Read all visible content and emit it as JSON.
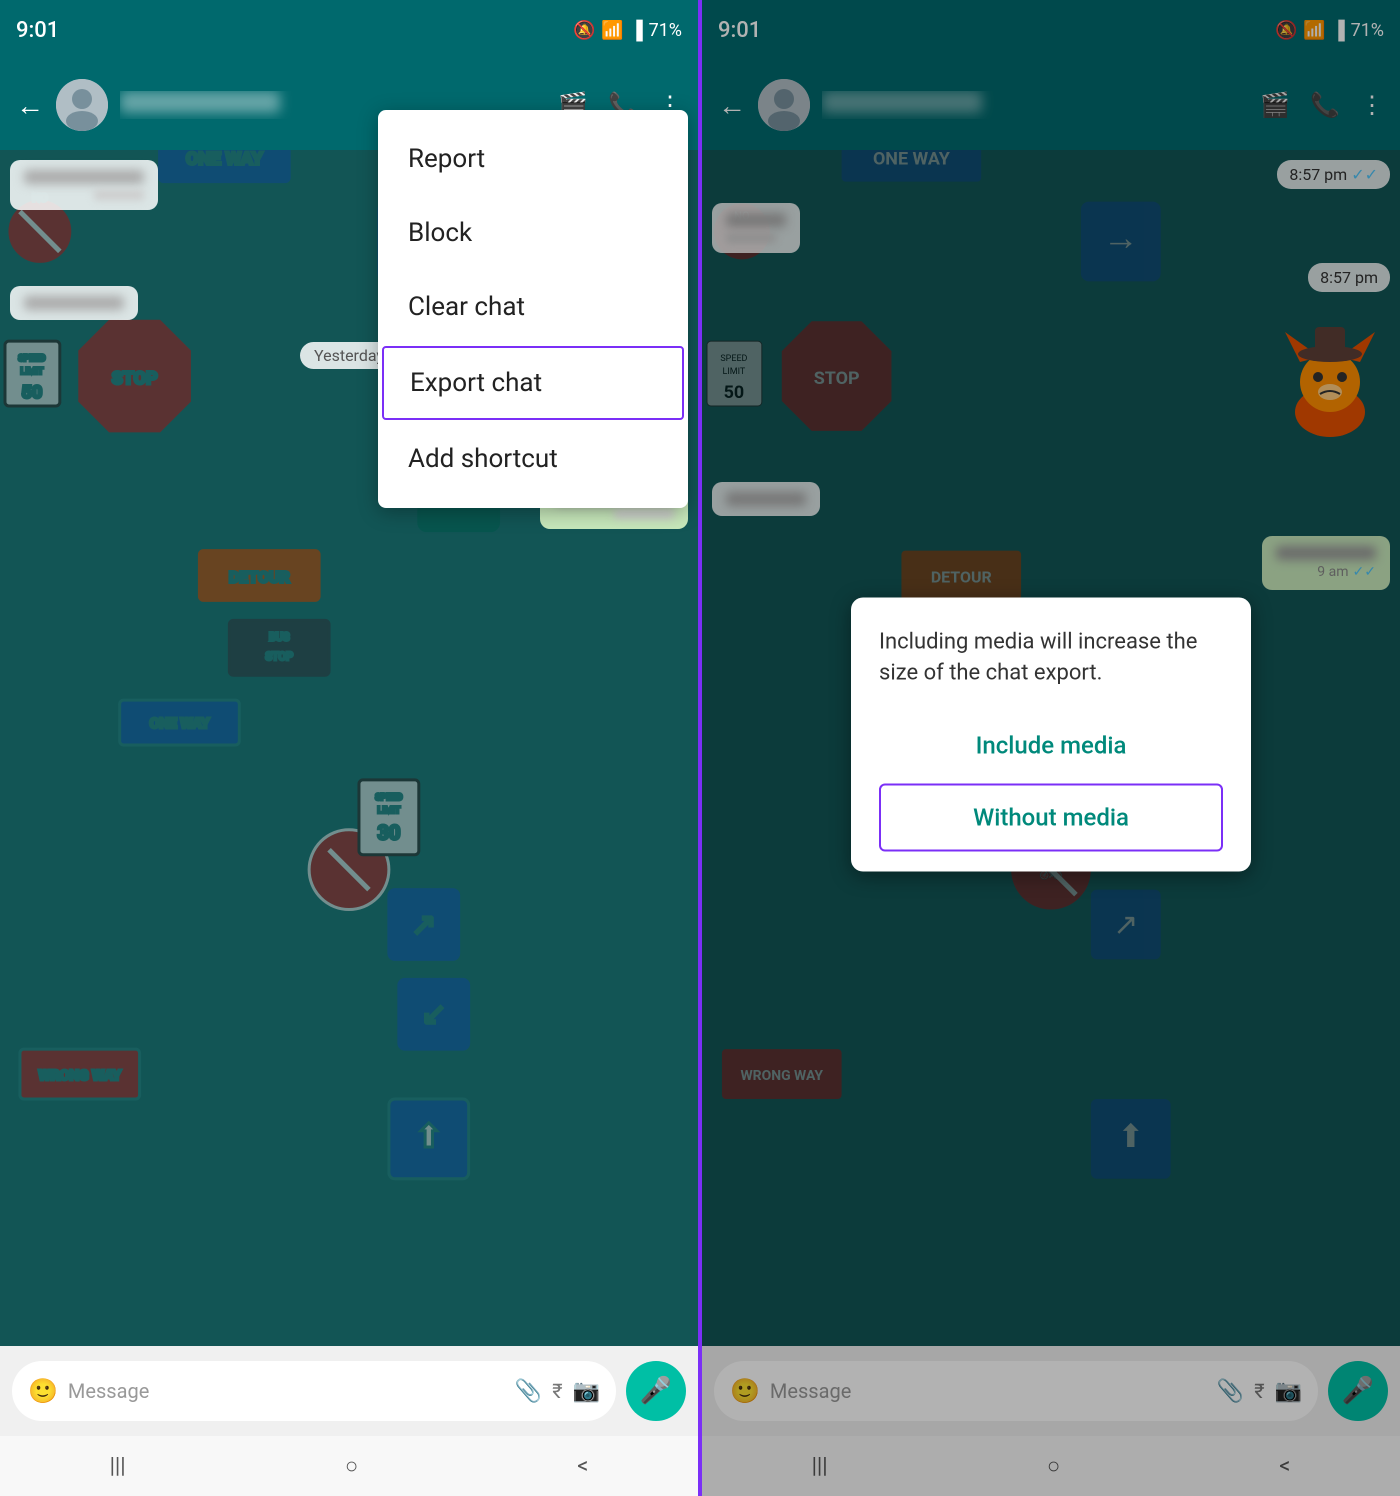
{
  "left_panel": {
    "status_bar": {
      "time": "9:01",
      "battery": "71%"
    },
    "header": {
      "back_label": "←",
      "contact_name": "",
      "video_icon": "📹",
      "phone_icon": "📞",
      "more_icon": "⋮"
    },
    "date_chip": "Yesterday",
    "input_placeholder": "Message",
    "menu_items": [
      {
        "label": "Report",
        "highlighted": false
      },
      {
        "label": "Block",
        "highlighted": false
      },
      {
        "label": "Clear chat",
        "highlighted": false
      },
      {
        "label": "Export chat",
        "highlighted": true
      },
      {
        "label": "Add shortcut",
        "highlighted": false
      }
    ],
    "nav": {
      "recent": "|||",
      "home": "○",
      "back": "<"
    }
  },
  "right_panel": {
    "status_bar": {
      "time": "9:01",
      "battery": "71%"
    },
    "header": {
      "back_label": "←"
    },
    "input_placeholder": "Message",
    "time_bubble_1": "8:57 pm",
    "time_bubble_2": "8:57 pm",
    "dialog": {
      "text": "Including media will increase the size of the chat export.",
      "include_media_label": "Include media",
      "without_media_label": "Without media"
    },
    "nav": {
      "recent": "|||",
      "home": "○",
      "back": "<"
    }
  }
}
